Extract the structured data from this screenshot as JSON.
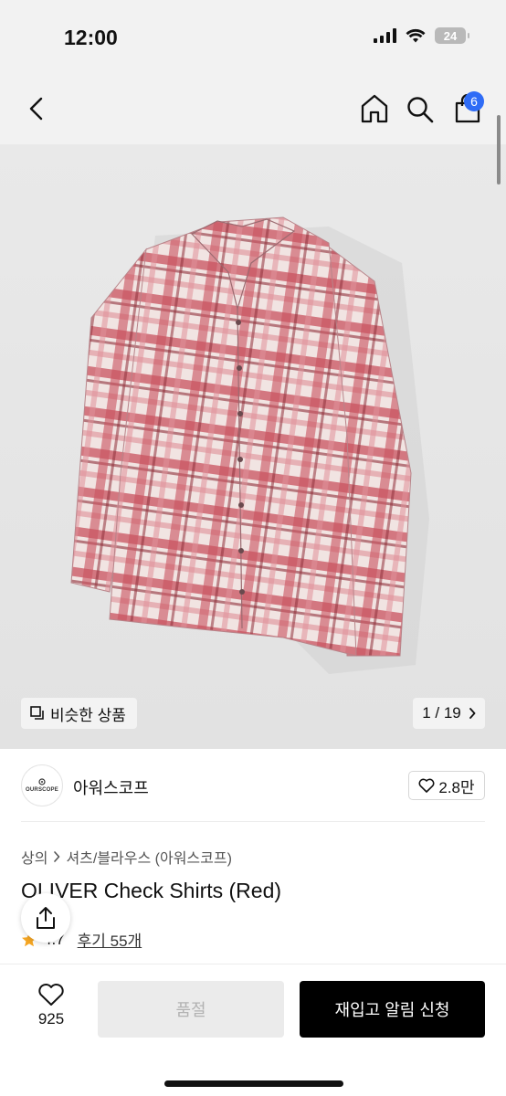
{
  "status_bar": {
    "time": "12:00",
    "battery": "24",
    "icons": [
      "signal-icon",
      "wifi-icon",
      "battery-icon"
    ]
  },
  "nav": {
    "icons": [
      "back-arrow-icon",
      "home-icon",
      "search-icon",
      "cart-icon"
    ],
    "cart_badge": "6"
  },
  "hero": {
    "image": "red-plaid-shirt",
    "similar_label": "비슷한 상품",
    "page_indicator": "1 / 19",
    "colors": {
      "plaid_base": "#f1e4e2",
      "plaid_red": "#c9525f",
      "plaid_rose": "#e08f98"
    }
  },
  "brand": {
    "logo_text": "OURSCOPE",
    "name": "아워스코프",
    "likes": "2.8만"
  },
  "product": {
    "breadcrumb": [
      "상의",
      "셔츠/블라우스 (아워스코프)"
    ],
    "title": "OLIVER Check Shirts (Red)",
    "rating": "4.7",
    "review_label": "후기 55개"
  },
  "bottom_bar": {
    "wish_count": "925",
    "soldout_label": "품절",
    "restock_label": "재입고 알림 신청"
  }
}
